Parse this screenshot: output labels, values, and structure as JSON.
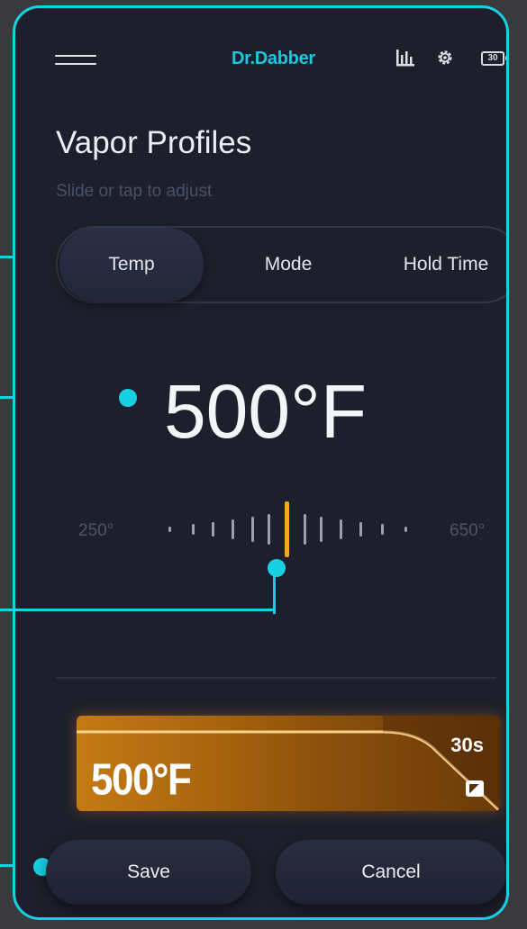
{
  "header": {
    "brand": "Dr.Dabber",
    "battery_level": "30",
    "icons": [
      "menu-icon",
      "stats-icon",
      "gear-icon",
      "battery-icon"
    ]
  },
  "page": {
    "title": "Vapor Profiles",
    "subtitle": "Slide or tap to adjust"
  },
  "tabs": [
    {
      "label": "Temp",
      "active": true
    },
    {
      "label": "Mode",
      "active": false
    },
    {
      "label": "Hold Time",
      "active": false
    }
  ],
  "temperature": {
    "value": "500°F",
    "min_label": "250°",
    "max_label": "650°"
  },
  "preset": {
    "temp": "500°F",
    "hold": "30s"
  },
  "buttons": {
    "save": "Save",
    "cancel": "Cancel"
  },
  "colors": {
    "accent": "#18d0e4",
    "brand": "#19c7de",
    "slider_active": "#f5a623",
    "background": "#1d1f2c"
  }
}
